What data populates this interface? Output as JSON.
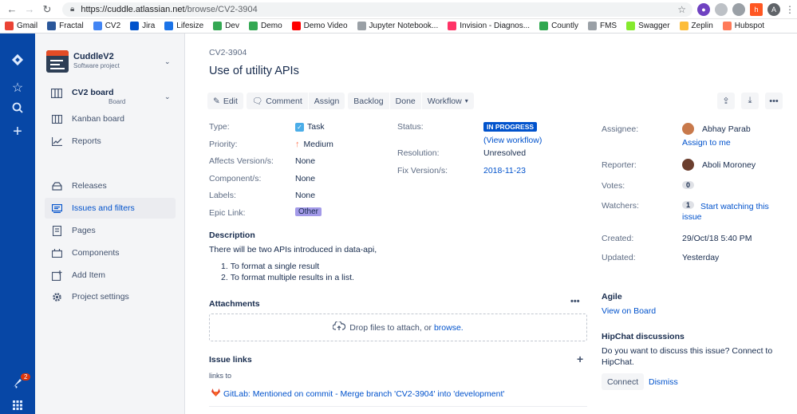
{
  "browser": {
    "url_host": "https://cuddle.atlassian.net",
    "url_path": "/browse/CV2-3904",
    "profile_initial": "A",
    "bookmarks": [
      {
        "label": "Gmail",
        "color": "#ea4335"
      },
      {
        "label": "Fractal",
        "color": "#2b579a"
      },
      {
        "label": "CV2",
        "color": "#4285f4"
      },
      {
        "label": "Jira",
        "color": "#0052cc"
      },
      {
        "label": "Lifesize",
        "color": "#1a73e8"
      },
      {
        "label": "Dev",
        "color": "#34a853"
      },
      {
        "label": "Demo",
        "color": "#34a853"
      },
      {
        "label": "Demo Video",
        "color": "#ff0000"
      },
      {
        "label": "Jupyter Notebook...",
        "color": "#9aa0a6"
      },
      {
        "label": "Invision - Diagnos...",
        "color": "#ff3366"
      },
      {
        "label": "Countly",
        "color": "#2fa84f"
      },
      {
        "label": "FMS",
        "color": "#9aa0a6"
      },
      {
        "label": "Swagger",
        "color": "#85ea2d"
      },
      {
        "label": "Zeplin",
        "color": "#fdbd39"
      },
      {
        "label": "Hubspot",
        "color": "#ff7a59"
      }
    ]
  },
  "global_nav": {
    "notification_count": "2"
  },
  "sidebar": {
    "project_name": "CuddleV2",
    "project_type": "Software project",
    "board_name": "CV2 board",
    "board_sub": "Board",
    "items": [
      {
        "label": "Kanban board",
        "icon": "kanban-icon"
      },
      {
        "label": "Reports",
        "icon": "reports-icon"
      },
      {
        "label": "Releases",
        "icon": "releases-icon"
      },
      {
        "label": "Issues and filters",
        "icon": "issues-icon"
      },
      {
        "label": "Pages",
        "icon": "pages-icon"
      },
      {
        "label": "Components",
        "icon": "components-icon"
      },
      {
        "label": "Add Item",
        "icon": "add-item-icon"
      },
      {
        "label": "Project settings",
        "icon": "settings-icon"
      }
    ]
  },
  "issue": {
    "key": "CV2-3904",
    "title": "Use of utility APIs",
    "toolbar": {
      "edit": "Edit",
      "comment": "Comment",
      "assign": "Assign",
      "backlog": "Backlog",
      "done": "Done",
      "workflow": "Workflow"
    },
    "fields": {
      "type_label": "Type:",
      "type_value": "Task",
      "priority_label": "Priority:",
      "priority_value": "Medium",
      "affects_label": "Affects Version/s:",
      "affects_value": "None",
      "component_label": "Component/s:",
      "component_value": "None",
      "labels_label": "Labels:",
      "labels_value": "None",
      "epic_label": "Epic Link:",
      "epic_value": "Other",
      "status_label": "Status:",
      "status_value": "IN PROGRESS",
      "view_workflow": "(View workflow)",
      "resolution_label": "Resolution:",
      "resolution_value": "Unresolved",
      "fix_label": "Fix Version/s:",
      "fix_value": "2018-11-23"
    },
    "description": {
      "title": "Description",
      "intro": "There will be two APIs introduced in data-api,",
      "items": [
        "To format a single result",
        "To format multiple results in a list."
      ]
    },
    "attachments": {
      "title": "Attachments",
      "drop_text": "Drop files to attach, or",
      "browse": "browse."
    },
    "issue_links": {
      "title": "Issue links",
      "relation": "links to",
      "link_text": "GitLab: Mentioned on commit - Merge branch 'CV2-3904' into 'development'"
    },
    "people": {
      "assignee_label": "Assignee:",
      "assignee": "Abhay Parab",
      "assign_to_me": "Assign to me",
      "reporter_label": "Reporter:",
      "reporter": "Aboli Moroney",
      "votes_label": "Votes:",
      "votes": "0",
      "watchers_label": "Watchers:",
      "watchers": "1",
      "start_watching": "Start watching this",
      "start_watching_2": "issue"
    },
    "dates": {
      "created_label": "Created:",
      "created": "29/Oct/18 5:40 PM",
      "updated_label": "Updated:",
      "updated": "Yesterday"
    },
    "agile": {
      "title": "Agile",
      "view_on_board": "View on Board"
    },
    "hipchat": {
      "title": "HipChat discussions",
      "text_1": "Do you want to discuss this issue? Connect to",
      "text_2": "HipChat.",
      "connect": "Connect",
      "dismiss": "Dismiss"
    }
  }
}
